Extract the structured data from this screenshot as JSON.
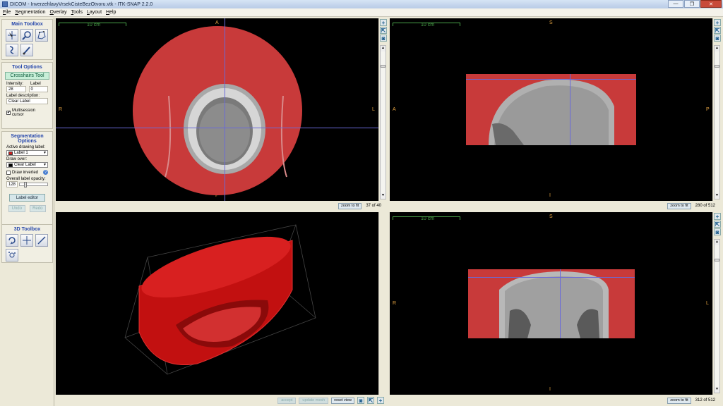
{
  "window": {
    "title": "DICOM - InverzehlavyVrsekCisteBezOtvoru.vtk - ITK-SNAP 2.2.0",
    "controls": [
      "—",
      "❐",
      "✕"
    ]
  },
  "menu": [
    "File",
    "Segmentation",
    "Overlay",
    "Tools",
    "Layout",
    "Help"
  ],
  "toolbox": {
    "main_title": "Main Toolbox",
    "tool_options_title": "Tool Options",
    "active_tool": "Crosshairs Tool",
    "intensity_label": "Intensity:",
    "intensity_value": "28",
    "label_label": "Label",
    "label_value": "0",
    "label_description_label": "Label description:",
    "label_description_value": "Clear Label",
    "multisession_label": "Multisession cursor",
    "segmentation_title": "Segmentation Options",
    "active_drawing_label": "Active drawing label:",
    "active_drawing_value": "Label 1",
    "active_drawing_color": "#d02020",
    "draw_over_label": "Draw over:",
    "draw_over_value": "Clear Label",
    "draw_inverted_label": "Draw inverted",
    "opacity_label": "Overall label opacity:",
    "opacity_value": "128",
    "label_editor_button": "Label editor",
    "undo_button": "Undo",
    "redo_button": "Redo",
    "toolbox3d_title": "3D Toolbox"
  },
  "views": {
    "axial": {
      "scale": "10 cm",
      "top": "A",
      "bottom": "P",
      "left": "R",
      "right": "L",
      "zoom": "zoom to fit",
      "slice": "37 of 40"
    },
    "sagittal": {
      "scale": "10 cm",
      "top": "S",
      "bottom": "I",
      "left": "A",
      "right": "P",
      "zoom": "zoom to fit",
      "slice": "280 of 512"
    },
    "coronal": {
      "scale": "10 cm",
      "top": "S",
      "bottom": "I",
      "left": "R",
      "right": "L",
      "zoom": "zoom to fit",
      "slice": "312 of 512"
    },
    "render3d": {
      "accept": "accept",
      "update": "update mesh",
      "reset": "reset view"
    }
  },
  "colors": {
    "segmentation_red": "#c83a3a",
    "crosshair": "#6a6ad8",
    "orientation": "#e0a040",
    "scale": "#4aa34a"
  }
}
